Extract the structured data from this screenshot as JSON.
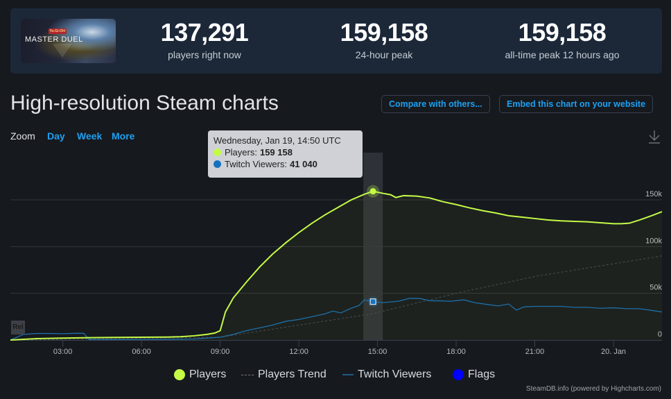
{
  "header": {
    "game_name": "Yu-Gi-Oh! Master Duel",
    "thumbnail": {
      "top_logo": "Yu-Gi-Oh!",
      "main_logo": "MASTER DUEL"
    },
    "stats": [
      {
        "value": "137,291",
        "label": "players right now"
      },
      {
        "value": "159,158",
        "label": "24-hour peak"
      },
      {
        "value": "159,158",
        "label": "all-time peak 12 hours ago"
      }
    ]
  },
  "page_title": "High-resolution Steam charts",
  "buttons": {
    "compare": "Compare with others...",
    "embed": "Embed this chart on your website"
  },
  "zoom": {
    "label": "Zoom",
    "options": [
      "Day",
      "Week",
      "More"
    ]
  },
  "icons": {
    "download": "download-icon"
  },
  "tooltip": {
    "title": "Wednesday, Jan 19, 14:50 UTC",
    "players_label": "Players:",
    "players_value": "159 158",
    "twitch_label": "Twitch Viewers:",
    "twitch_value": "41 040"
  },
  "colors": {
    "players": "#c4fb46",
    "trend": "#5a5f66",
    "twitch": "#1e6fa8",
    "flags": "#0000ff",
    "accent": "#1ea0f0"
  },
  "flag_label": "Rel",
  "legend": [
    "Players",
    "Players Trend",
    "Twitch Viewers",
    "Flags"
  ],
  "credit": "SteamDB.info (powered by Highcharts.com)",
  "chart_data": {
    "type": "line",
    "title": "High-resolution Steam charts",
    "xlabel": "",
    "ylabel": "",
    "x_unit": "hours since 2022-01-19 00:00 UTC",
    "xlim": [
      1.0,
      25.85
    ],
    "ylim": [
      0,
      160000
    ],
    "y_ticks": [
      0,
      50000,
      100000,
      150000
    ],
    "y_tick_labels": [
      "0",
      "50k",
      "100k",
      "150k"
    ],
    "x_ticks": [
      3,
      6,
      9,
      12,
      15,
      18,
      21,
      24
    ],
    "x_tick_labels": [
      "03:00",
      "06:00",
      "09:00",
      "12:00",
      "15:00",
      "18:00",
      "21:00",
      "20. Jan"
    ],
    "grid": true,
    "legend_position": "bottom-center",
    "highlight": {
      "x": 14.83,
      "players": 159158,
      "twitch": 41040
    },
    "flags": [
      {
        "x": 1.05,
        "label": "Rel"
      }
    ],
    "series": [
      {
        "name": "Players",
        "x": [
          1.0,
          2.0,
          3.0,
          4.0,
          5.0,
          6.0,
          7.0,
          7.5,
          8.0,
          8.5,
          8.8,
          9.0,
          9.2,
          9.5,
          10.0,
          10.5,
          11.0,
          11.5,
          12.0,
          12.5,
          13.0,
          13.5,
          14.0,
          14.5,
          14.83,
          15.2,
          15.5,
          15.7,
          16.0,
          16.5,
          17.0,
          17.5,
          18.0,
          18.5,
          19.0,
          19.5,
          20.0,
          20.5,
          21.0,
          21.5,
          22.0,
          22.5,
          23.0,
          23.5,
          24.0,
          24.3,
          24.6,
          25.0,
          25.5,
          25.85
        ],
        "values": [
          0,
          1500,
          2000,
          2500,
          2800,
          3000,
          3200,
          3500,
          4500,
          6000,
          7500,
          10000,
          30000,
          45000,
          62000,
          78000,
          92000,
          104000,
          115000,
          125000,
          134000,
          142000,
          150000,
          156000,
          159158,
          157000,
          155500,
          152500,
          154500,
          154000,
          152000,
          148000,
          145000,
          141500,
          138500,
          136000,
          133000,
          131500,
          130000,
          128500,
          127500,
          127000,
          126500,
          125500,
          124500,
          124500,
          125000,
          128500,
          133500,
          137291
        ]
      },
      {
        "name": "Players Trend",
        "x": [
          1.0,
          9.0,
          14.8,
          18.0,
          21.0,
          25.85
        ],
        "values": [
          0,
          3000,
          28000,
          50000,
          68000,
          90000
        ]
      },
      {
        "name": "Twitch Viewers",
        "x": [
          1.0,
          1.5,
          2.0,
          2.5,
          3.0,
          3.5,
          3.8,
          4.0,
          5.0,
          6.0,
          7.0,
          8.0,
          9.0,
          9.5,
          10.0,
          10.5,
          11.0,
          11.5,
          12.0,
          12.5,
          13.0,
          13.3,
          13.6,
          14.0,
          14.3,
          14.5,
          14.83,
          15.2,
          15.8,
          16.2,
          16.6,
          17.0,
          17.3,
          17.8,
          18.3,
          18.7,
          19.2,
          19.6,
          20.0,
          20.3,
          20.6,
          21.0,
          21.5,
          22.0,
          22.5,
          23.0,
          23.5,
          24.0,
          24.5,
          25.0,
          25.5,
          25.85
        ],
        "values": [
          0,
          6000,
          7000,
          7000,
          6800,
          7200,
          7200,
          400,
          500,
          600,
          700,
          1000,
          3000,
          6000,
          10000,
          13000,
          16000,
          20000,
          22000,
          25000,
          28000,
          31000,
          29000,
          34000,
          37000,
          43000,
          41040,
          40000,
          41500,
          44500,
          44500,
          42000,
          42000,
          41500,
          43000,
          40000,
          38000,
          36500,
          38500,
          32000,
          35500,
          36000,
          36000,
          36000,
          35000,
          35000,
          34000,
          34500,
          33500,
          33500,
          31500,
          30000
        ]
      }
    ]
  }
}
